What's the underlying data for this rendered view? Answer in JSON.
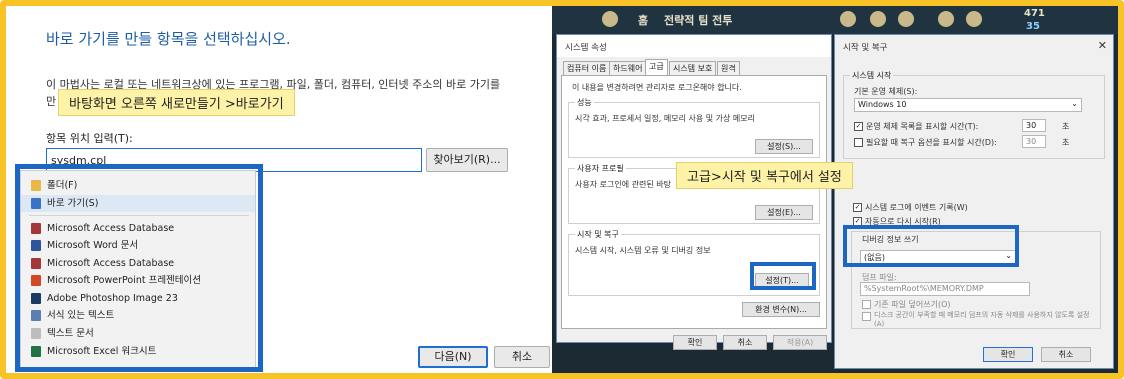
{
  "left_panel": {
    "title": "바로 가기를 만들 항목을 선택하십시오.",
    "description_line1": "이 마법사는 로컬 또는 네트워크상에 있는 프로그램, 파일, 폴더, 컴퓨터, 인터넷 주소의 바로 가기를",
    "description_line2": "만",
    "location_label": "항목 위치 입력(T):",
    "location_value": "sysdm.cpl",
    "browse_button": "찾아보기(R)...",
    "next_button": "다음(N)",
    "cancel_button": "취소",
    "callout": "바탕화면 오른쪽 새로만들기 >바로가기",
    "menu_items": [
      {
        "label": "폴더(F)",
        "icon": "folder-icon",
        "color": "#e8b849"
      },
      {
        "label": "바로 가기(S)",
        "icon": "shortcut-icon",
        "color": "#3a72c7"
      },
      {
        "label": "Microsoft Access Database",
        "icon": "access-icon",
        "color": "#a4373a"
      },
      {
        "label": "Microsoft Word 문서",
        "icon": "word-icon",
        "color": "#2b579a"
      },
      {
        "label": "Microsoft Access Database",
        "icon": "access-icon",
        "color": "#a4373a"
      },
      {
        "label": "Microsoft PowerPoint 프레젠테이션",
        "icon": "powerpoint-icon",
        "color": "#d24726"
      },
      {
        "label": "Adobe Photoshop Image 23",
        "icon": "photoshop-icon",
        "color": "#1c3b63"
      },
      {
        "label": "서식 있는 텍스트",
        "icon": "rtf-icon",
        "color": "#5a7fb5"
      },
      {
        "label": "텍스트 문서",
        "icon": "text-icon",
        "color": "#bdbdbd"
      },
      {
        "label": "Microsoft Excel 워크시트",
        "icon": "excel-icon",
        "color": "#217346"
      }
    ]
  },
  "game_bar": {
    "home_label": "홈",
    "tft_label": "전략적 팀 전투",
    "currency1": "471",
    "currency2": "35"
  },
  "system_props": {
    "title": "시스템 속성",
    "tabs": [
      "컴퓨터 이름",
      "하드웨어",
      "고급",
      "시스템 보호",
      "원격"
    ],
    "admin_note": "이 내용을 변경하려면 관리자로 로그온해야 합니다.",
    "perf_title": "성능",
    "perf_desc": "시각 효과, 프로세서 일정, 메모리 사용 및 가상 메모리",
    "perf_button": "설정(S)...",
    "profile_title": "사용자 프로필",
    "profile_desc": "사용자 로그인에 관련된 바탕",
    "profile_button": "설정(E)...",
    "startup_title": "시작 및 복구",
    "startup_desc": "시스템 시작, 시스템 오류 및 디버깅 정보",
    "startup_button": "설정(T)...",
    "env_button": "환경 변수(N)...",
    "ok": "확인",
    "cancel": "취소",
    "apply": "적용(A)",
    "callout": "고급>시작 및 복구에서 설정"
  },
  "startup_recovery": {
    "title": "시작 및 복구",
    "system_startup": "시스템 시작",
    "default_os_label": "기본 운영 체제(S):",
    "default_os_value": "Windows 10",
    "show_os_list": "운영 체제 목록을 표시할 시간(T):",
    "show_os_value": "30",
    "show_recovery": "필요할 때 복구 옵션을 표시할 시간(D):",
    "show_recovery_value": "30",
    "sec": "초",
    "log_event": "시스템 로그에 이벤트 기록(W)",
    "auto_restart": "자동으로 다시 시작(R)",
    "debug_write": "디버깅 정보 쓰기",
    "debug_value": "(없음)",
    "dump_file_label": "덤프 파일:",
    "dump_file_value": "%SystemRoot%\\MEMORY.DMP",
    "overwrite": "기존 파일 덮어쓰기(O)",
    "disable_auto": "디스크 공간이 부족할 때 메모리 덤프의 자동 삭제를 사용하지 않도록 설정(A)",
    "ok": "확인",
    "cancel": "취소"
  }
}
